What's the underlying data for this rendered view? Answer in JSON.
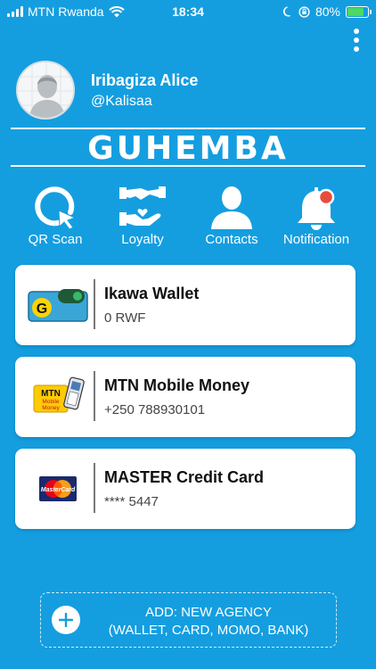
{
  "status_bar": {
    "carrier": "MTN Rwanda",
    "time": "18:34",
    "battery": "80%",
    "battery_level": 0.8,
    "accent": "#4cd964"
  },
  "profile": {
    "name": "Iribagiza Alice",
    "handle": "@Kalisaa"
  },
  "brand": "GUHEMBA",
  "actions": [
    {
      "label": "QR Scan",
      "icon": "qr-scan-icon"
    },
    {
      "label": "Loyalty",
      "icon": "loyalty-handshake-icon"
    },
    {
      "label": "Contacts",
      "icon": "contacts-person-icon"
    },
    {
      "label": "Notification",
      "icon": "bell-icon"
    }
  ],
  "cards": [
    {
      "title": "Ikawa Wallet",
      "sub": "0 RWF",
      "icon": "wallet-icon"
    },
    {
      "title": "MTN Mobile Money",
      "sub": "+250 788930101",
      "icon": "mtn-mobile-money-logo",
      "logo_text": "MTN Mobile Money"
    },
    {
      "title": "MASTER Credit Card",
      "sub": "**** 5447",
      "icon": "mastercard-logo",
      "logo_text": "MasterCard"
    }
  ],
  "add_agency": {
    "line1": "ADD: NEW AGENCY",
    "line2": "(WALLET, CARD, MOMO, BANK)"
  },
  "colors": {
    "background": "#149ee0",
    "card": "#ffffff",
    "notification_dot": "#e74c3c"
  }
}
